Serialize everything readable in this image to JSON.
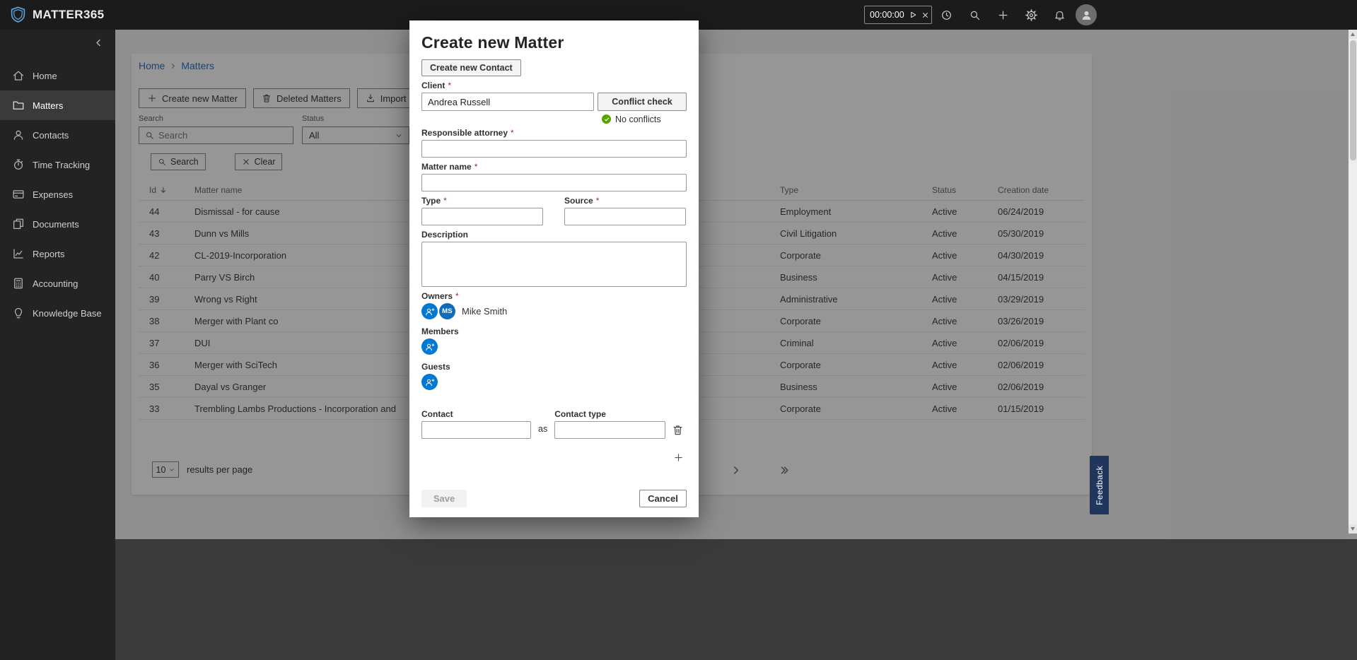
{
  "topbar": {
    "brand": "MATTER365",
    "timer": {
      "value": "00:00:00"
    }
  },
  "sidebar": {
    "items": [
      {
        "label": "Home",
        "icon": "home",
        "active": false
      },
      {
        "label": "Matters",
        "icon": "folder",
        "active": true
      },
      {
        "label": "Contacts",
        "icon": "person",
        "active": false
      },
      {
        "label": "Time Tracking",
        "icon": "stopwatch",
        "active": false
      },
      {
        "label": "Expenses",
        "icon": "card",
        "active": false
      },
      {
        "label": "Documents",
        "icon": "docs",
        "active": false
      },
      {
        "label": "Reports",
        "icon": "chart",
        "active": false
      },
      {
        "label": "Accounting",
        "icon": "calc",
        "active": false
      },
      {
        "label": "Knowledge Base",
        "icon": "bulb",
        "active": false
      }
    ]
  },
  "main": {
    "breadcrumb": {
      "home": "Home",
      "current": "Matters"
    },
    "toolbar": {
      "create_matter": "Create new Matter",
      "deleted_matters": "Deleted Matters",
      "import_matters": "Import Matters"
    },
    "filters": {
      "search_label": "Search",
      "search_placeholder": "Search",
      "status_label": "Status",
      "status_value": "All",
      "search_button": "Search",
      "clear_button": "Clear"
    },
    "table": {
      "headers": {
        "id": "Id",
        "name": "Matter name",
        "type": "Type",
        "status": "Status",
        "date": "Creation date"
      },
      "rows": [
        {
          "id": "44",
          "name": "Dismissal - for cause",
          "type": "Employment",
          "status": "Active",
          "date": "06/24/2019"
        },
        {
          "id": "43",
          "name": "Dunn vs Mills",
          "type": "Civil Litigation",
          "status": "Active",
          "date": "05/30/2019"
        },
        {
          "id": "42",
          "name": "CL-2019-Incorporation",
          "type": "Corporate",
          "status": "Active",
          "date": "04/30/2019"
        },
        {
          "id": "40",
          "name": "Parry VS Birch",
          "type": "Business",
          "status": "Active",
          "date": "04/15/2019"
        },
        {
          "id": "39",
          "name": "Wrong vs Right",
          "type": "Administrative",
          "status": "Active",
          "date": "03/29/2019"
        },
        {
          "id": "38",
          "name": "Merger with Plant co",
          "type": "Corporate",
          "status": "Active",
          "date": "03/26/2019"
        },
        {
          "id": "37",
          "name": "DUI",
          "type": "Criminal",
          "status": "Active",
          "date": "02/06/2019"
        },
        {
          "id": "36",
          "name": "Merger with SciTech",
          "type": "Corporate",
          "status": "Active",
          "date": "02/06/2019"
        },
        {
          "id": "35",
          "name": "Dayal vs Granger",
          "type": "Business",
          "status": "Active",
          "date": "02/06/2019"
        },
        {
          "id": "33",
          "name": "Trembling Lambs Productions - Incorporation and",
          "type": "Corporate",
          "status": "Active",
          "date": "01/15/2019"
        }
      ]
    },
    "pagination": {
      "per_page": "10",
      "label": "results per page"
    }
  },
  "modal": {
    "title": "Create new Matter",
    "create_contact_button": "Create new Contact",
    "client": {
      "label": "Client",
      "required": "*",
      "value": "Andrea Russell"
    },
    "conflict_check_button": "Conflict check",
    "conflict_status": "No conflicts",
    "responsible_attorney": {
      "label": "Responsible attorney",
      "required": "*",
      "value": ""
    },
    "matter_name": {
      "label": "Matter name",
      "required": "*",
      "value": ""
    },
    "type": {
      "label": "Type",
      "required": "*",
      "value": ""
    },
    "source": {
      "label": "Source",
      "required": "*",
      "value": ""
    },
    "description": {
      "label": "Description",
      "value": ""
    },
    "owners": {
      "label": "Owners",
      "required": "*",
      "initials": "MS",
      "name": "Mike Smith"
    },
    "members": {
      "label": "Members"
    },
    "guests": {
      "label": "Guests"
    },
    "contact": {
      "label": "Contact",
      "value": ""
    },
    "as_label": "as",
    "contact_type": {
      "label": "Contact type",
      "value": ""
    },
    "save_button": "Save",
    "cancel_button": "Cancel"
  },
  "feedback_tab": "Feedback",
  "colors": {
    "accent_blue": "#0078d4",
    "link_blue": "#1873c8",
    "success_green": "#57a300",
    "required_red": "#a4262c",
    "feedback_navy": "#20365c"
  },
  "icon_map": {
    "brand-logo-icon": "shield",
    "history-icon": "clock",
    "search-icon": "magnifier",
    "add-icon": "plus",
    "settings-icon": "gear",
    "notifications-icon": "bell",
    "avatar-icon": "person",
    "collapse-icon": "chevron-left",
    "home-icon": "house",
    "folder-icon": "folder",
    "person-icon": "person",
    "stopwatch-icon": "stopwatch",
    "card-icon": "credit-card",
    "docs-icon": "pages",
    "chart-icon": "line-chart",
    "calc-icon": "calculator",
    "bulb-icon": "lightbulb",
    "trash-icon": "trash",
    "import-icon": "download-arrow",
    "sort-descending-icon": "arrow-down",
    "dropdown-icon": "chevron-down",
    "clear-icon": "x",
    "check-icon": "checkmark",
    "add-person-icon": "person-plus",
    "next-page-icon": "chevron-right",
    "last-page-icon": "double-chevron-right"
  }
}
